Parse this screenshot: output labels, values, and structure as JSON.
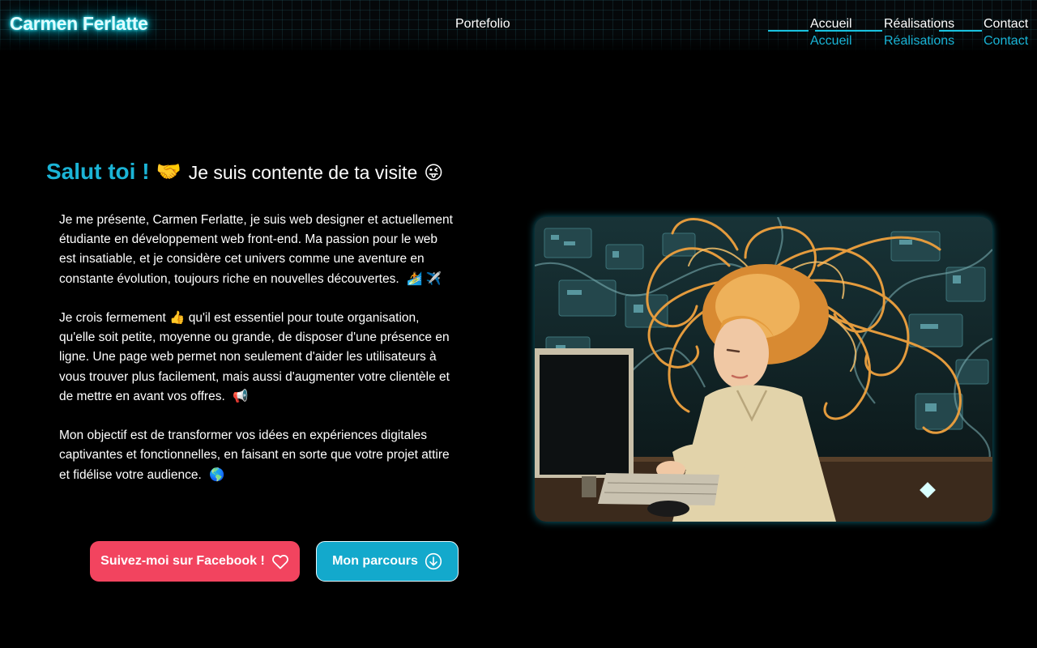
{
  "header": {
    "logo": "Carmen Ferlatte",
    "center_link": "Portefolio",
    "nav": [
      {
        "label": "Accueil"
      },
      {
        "label": "Réalisations"
      },
      {
        "label": "Contact"
      }
    ],
    "accent_color": "#19c3e0"
  },
  "hero": {
    "title_highlight": "Salut toi !",
    "title_emoji": "🤝",
    "title_rest": "Je suis contente de ta visite",
    "title_end_emoji": "😜",
    "paragraphs": [
      {
        "text": "Je me présente, Carmen Ferlatte, je suis web designer et actuellement étudiante en développement web front-end. Ma passion pour le web est insatiable, et je considère cet univers comme une aventure en constante évolution, toujours riche en nouvelles découvertes.",
        "emojis": "🏄 ✈️"
      },
      {
        "text_before": "Je crois fermement",
        "emoji_mid": "👍",
        "text_after": "qu'il est essentiel pour toute organisation, qu'elle soit petite, moyenne ou grande, de disposer d'une présence en ligne. Une page web permet non seulement d'aider les utilisateurs à vous trouver plus facilement, mais aussi d'augmenter votre clientèle et de mettre en avant vos offres.",
        "emoji_end": "📢"
      },
      {
        "text": "Mon objectif est de transformer vos idées en expériences digitales captivantes et fonctionnelles, en faisant en sorte que votre projet attire et fidélise votre audience.",
        "emoji_end": "🌎"
      }
    ],
    "buttons": {
      "facebook": {
        "label": "Suivez-moi sur Facebook !",
        "icon": "heart-icon",
        "color": "#f2445f"
      },
      "parcours": {
        "label": "Mon parcours",
        "icon": "arrow-down-circle-icon",
        "color": "#13a9cc"
      }
    }
  },
  "illustration": {
    "subject": "woman-with-flowing-orange-hair-at-computer"
  }
}
